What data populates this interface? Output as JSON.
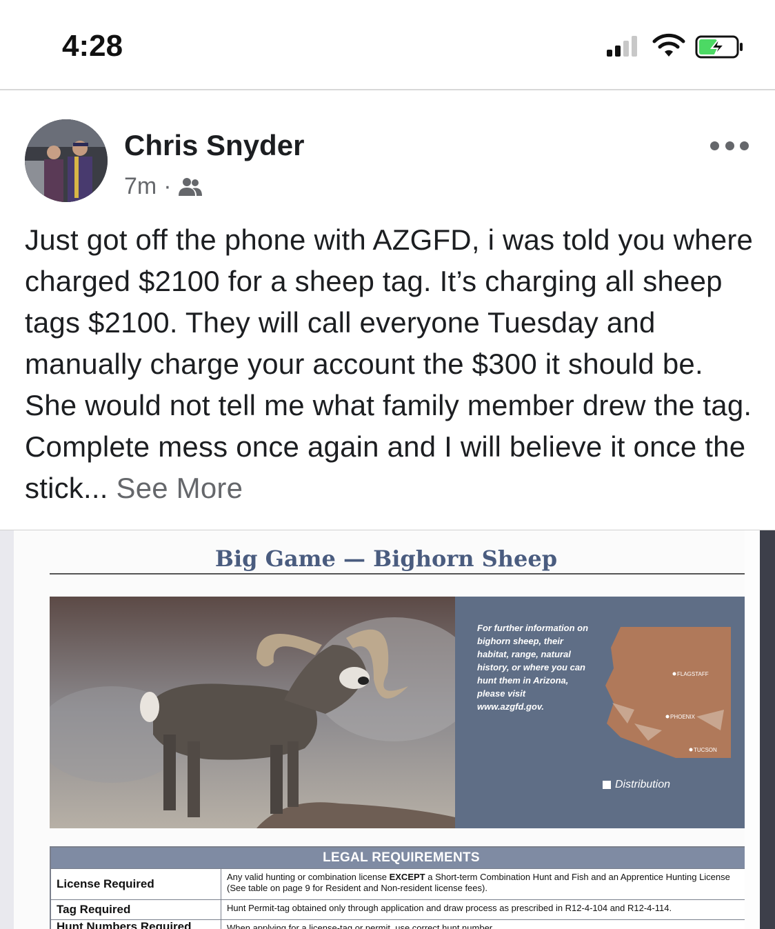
{
  "status_bar": {
    "time": "4:28"
  },
  "post": {
    "author": "Chris Snyder",
    "time_ago": "7m",
    "separator": "·",
    "audience_icon": "friends-icon",
    "text": "Just got off the phone with AZGFD, i was told you where charged $2100 for a sheep tag. It’s charging all sheep tags $2100. They will call everyone Tuesday and manually charge your account the $300 it should be. She would not tell me what family member drew the tag. Complete mess once again and I will believe it once the stick...",
    "see_more": "See More"
  },
  "attachment": {
    "title": "Big Game — Bighorn Sheep",
    "info_text": "For further information on bighorn sheep, their habitat, range, natural history, or where you can hunt them in Arizona, please visit www.azgfd.gov.",
    "map_labels": {
      "flagstaff": "FLAGSTAFF",
      "phoenix": "PHOENIX",
      "tucson": "TUCSON"
    },
    "legend": "Distribution",
    "table": {
      "header": "LEGAL REQUIREMENTS",
      "rows": [
        {
          "label": "License Required",
          "value_a": "Any valid hunting or combination license",
          "value_b": "EXCEPT",
          "value_c": "a Short-term Combination Hunt and Fish and an Apprentice Hunting License",
          "value_d": "(See table on page 9 for Resident and Non-resident license fees)."
        },
        {
          "label": "Tag Required",
          "value": "Hunt Permit-tag obtained only through application and draw process as prescribed in R12-4-104 and R12-4-114."
        },
        {
          "label": "Hunt Numbers Required",
          "value": "When applying for a license-tag or permit, use correct hunt number."
        }
      ]
    }
  },
  "colors": {
    "panel": "#5f6e86",
    "map_fill": "#b0795a",
    "table_header": "#7f8ba3",
    "see_more": "#65676b"
  }
}
